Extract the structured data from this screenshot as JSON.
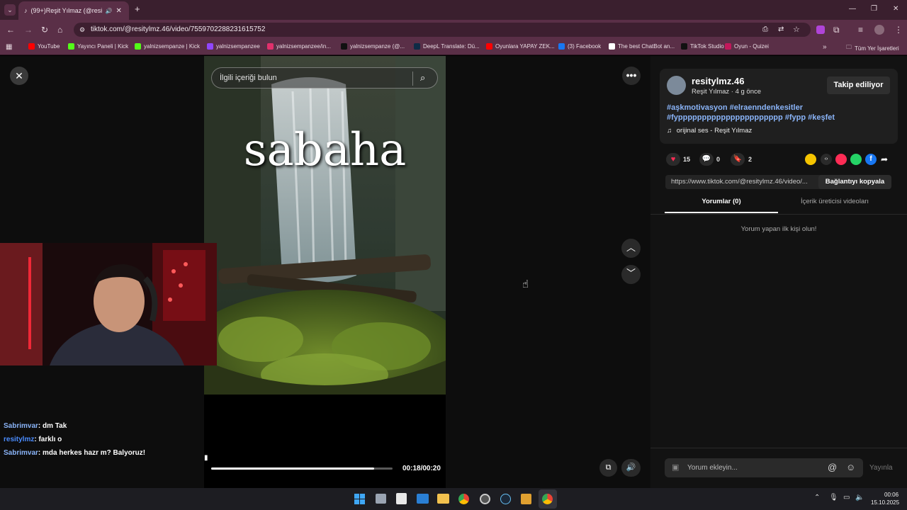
{
  "browser": {
    "tab_title": "(99+)Reşit Yılmaz (@resityl",
    "url": "tiktok.com/@resitylmz.46/video/7559702288231615752",
    "bookmarks": [
      {
        "label": "YouTube",
        "color": "#ff0000"
      },
      {
        "label": "Yayıncı Paneli | Kick",
        "color": "#53fc18"
      },
      {
        "label": "yalnizsempanze | Kick",
        "color": "#53fc18"
      },
      {
        "label": "yalnizsempanzee",
        "color": "#9146ff"
      },
      {
        "label": "yalnizsempanzee/in...",
        "color": "#e1306c"
      },
      {
        "label": "yalnizsempanze (@...",
        "color": "#111111"
      },
      {
        "label": "DeepL Translate: Dü...",
        "color": "#0f2b46"
      },
      {
        "label": "Oyunlara YAPAY ZEK...",
        "color": "#ff0000"
      },
      {
        "label": "(3) Facebook",
        "color": "#1877f2"
      },
      {
        "label": "The best ChatBot an...",
        "color": "#ffffff"
      },
      {
        "label": "TikTok Studio",
        "color": "#111111"
      },
      {
        "label": "Oyun - Quizei",
        "color": "#c2185b"
      }
    ],
    "all_bookmarks": "Tüm Yer İşaretleri"
  },
  "video": {
    "search_placeholder": "İlgili içeriği bulun",
    "overlay_text": "sabaha",
    "time": "00:18/00:20",
    "progress": 0.9
  },
  "chat": [
    {
      "user": "Sabrimvar",
      "text": ": dm Tak",
      "color": "#8ab4f8"
    },
    {
      "user": "resitylmz",
      "text": ": farklı o",
      "color": "#4a8cff"
    },
    {
      "user": "Sabrimvar",
      "text": ": mda herkes hazr m? Balyoruz!",
      "color": "#8ab4f8"
    }
  ],
  "sidebar": {
    "username": "resitylmz.46",
    "subtitle": "Reşit Yılmaz · 4 g önce",
    "follow_label": "Takip ediliyor",
    "hashtags": "#aşkmotivasyon #elraenndenkesitler #fypppppppppppppppppppppp #fypp #keşfet",
    "sound": "orijinal ses - Reşit Yılmaz",
    "likes": "15",
    "comments": "0",
    "saves": "2",
    "link": "https://www.tiktok.com/@resitylmz.46/video/...",
    "copy_label": "Bağlantıyı kopyala",
    "tab_comments": "Yorumlar (0)",
    "tab_creator": "İçerik üreticisi videoları",
    "empty_comments": "Yorum yapan ilk kişi olun!",
    "comment_placeholder": "Yorum ekleyin...",
    "post_label": "Yayınla"
  },
  "taskbar": {
    "time": "00:06",
    "date": "15.10.2025"
  },
  "colors": {
    "tiktok_red": "#fe2c55",
    "link_blue": "#8ab4f8",
    "chrome_tab": "#5a2f47"
  }
}
